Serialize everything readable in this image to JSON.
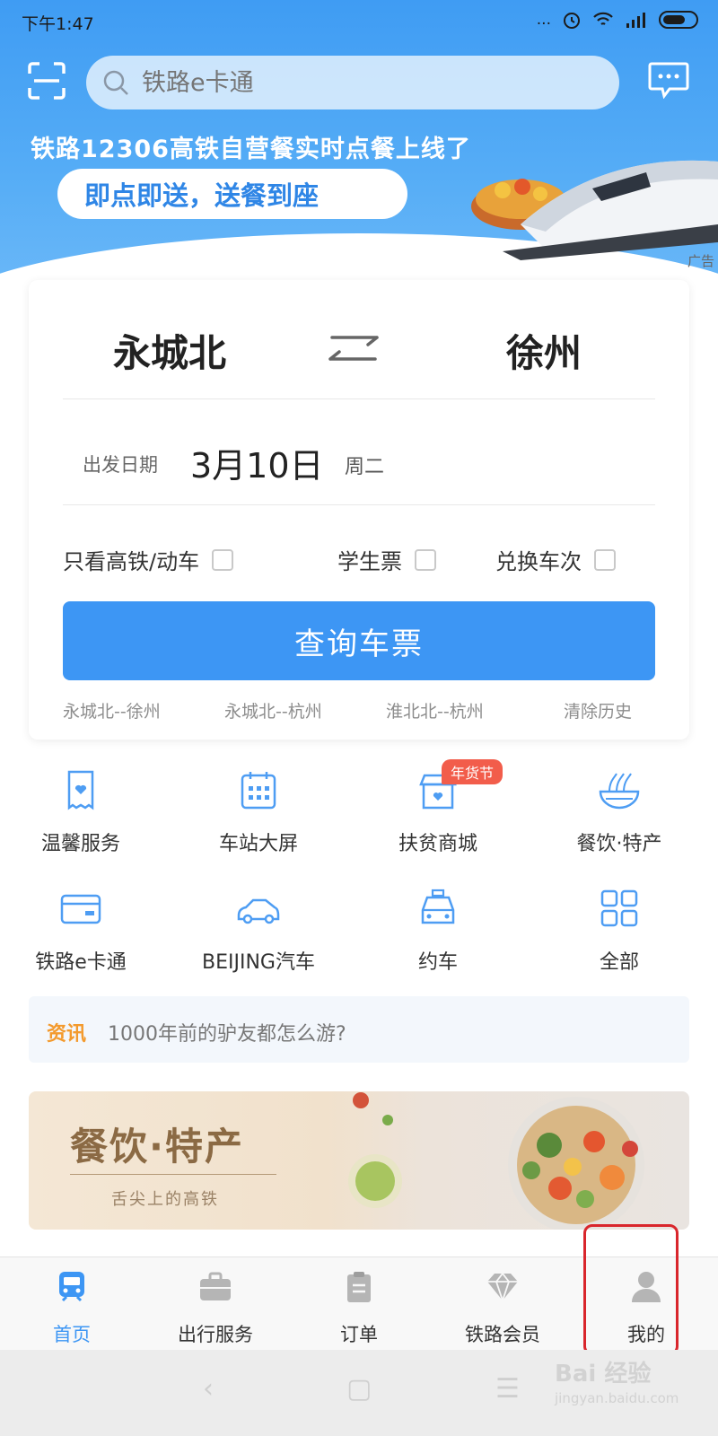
{
  "status_bar": {
    "time": "下午1:47",
    "dots": "..."
  },
  "header": {
    "search_placeholder": "铁路e卡通",
    "icons": [
      "scan-icon",
      "search-icon",
      "message-icon"
    ]
  },
  "banner": {
    "title": "铁路12306高铁自营餐实时点餐上线了",
    "pill": "即点即送，送餐到座",
    "ad_label": "广告"
  },
  "query": {
    "from": "永城北",
    "to": "徐州",
    "date_label": "出发日期",
    "date": "3月10日",
    "weekday": "周二",
    "options": [
      "只看高铁/动车",
      "学生票",
      "兑换车次"
    ],
    "button": "查询车票",
    "history": [
      "永城北--徐州",
      "永城北--杭州",
      "淮北北--杭州"
    ],
    "clear_history": "清除历史"
  },
  "grid": {
    "items": [
      {
        "label": "温馨服务",
        "icon": "receipt-heart-icon"
      },
      {
        "label": "车站大屏",
        "icon": "calendar-icon"
      },
      {
        "label": "扶贫商城",
        "icon": "shop-icon"
      },
      {
        "label": "餐饮·特产",
        "icon": "noodle-bowl-icon"
      },
      {
        "label": "铁路e卡通",
        "icon": "card-icon"
      },
      {
        "label": "BEIJING汽车",
        "icon": "car-icon"
      },
      {
        "label": "约车",
        "icon": "taxi-icon"
      },
      {
        "label": "全部",
        "icon": "grid-icon"
      }
    ],
    "badge": "年货节"
  },
  "news": {
    "tag": "资讯",
    "text": "1000年前的驴友都怎么游?"
  },
  "promo": {
    "title": "餐饮·特产",
    "subtitle": "舌尖上的高铁"
  },
  "nav": {
    "items": [
      {
        "label": "首页",
        "icon": "train-icon",
        "active": true
      },
      {
        "label": "出行服务",
        "icon": "briefcase-icon",
        "active": false
      },
      {
        "label": "订单",
        "icon": "clipboard-icon",
        "active": false
      },
      {
        "label": "铁路会员",
        "icon": "diamond-icon",
        "active": false
      },
      {
        "label": "我的",
        "icon": "person-icon",
        "active": false
      }
    ]
  },
  "watermark": {
    "brand": "Bai 经验",
    "url": "jingyan.baidu.com"
  },
  "colors": {
    "primary": "#3d96f4",
    "header": "#3f9cf3",
    "badge": "#f25d4b",
    "news_tag": "#f39a2d",
    "highlight": "#d9262c"
  }
}
